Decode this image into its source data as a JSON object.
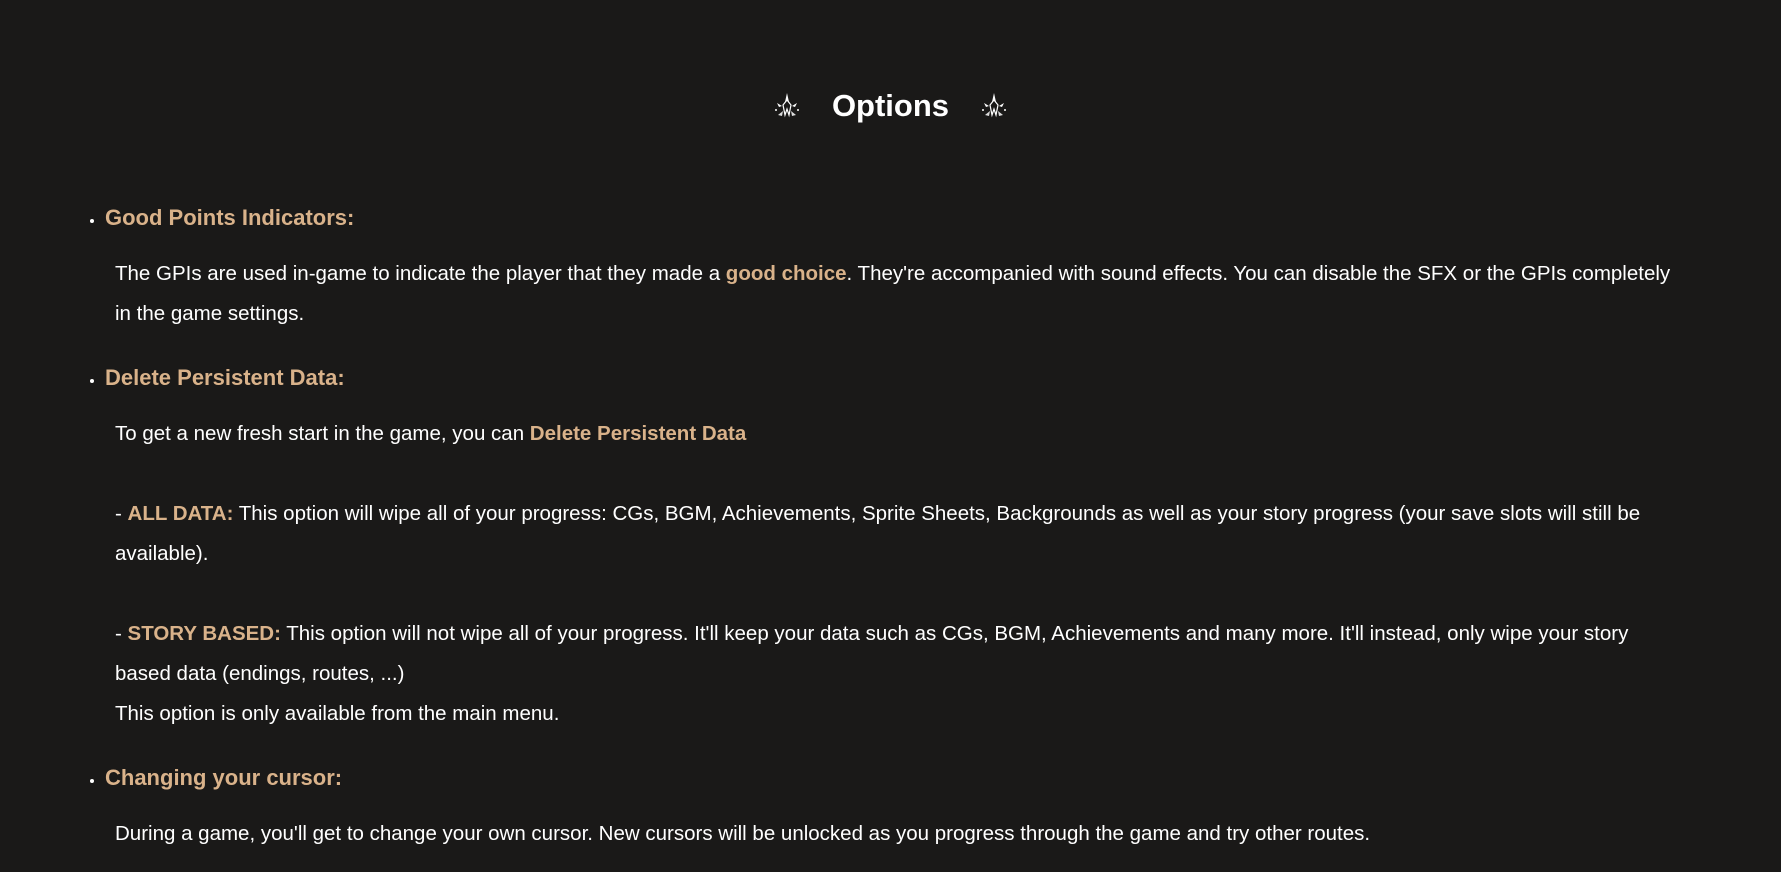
{
  "header": {
    "title": "Options",
    "decor_icon": "star-burst-icon"
  },
  "colors": {
    "background": "#1a1918",
    "accent": "#d9b28a",
    "text": "#ffffff"
  },
  "sections": {
    "gpi": {
      "heading": "Good Points Indicators:",
      "p1_a": "The GPIs are used in-game to indicate the player that they made a ",
      "p1_hl": "good choice",
      "p1_b": ". They're accompanied with sound effects. You can disable the SFX or the GPIs completely in the game settings."
    },
    "delete": {
      "heading": "Delete Persistent Data:",
      "p1_a": "To get a new fresh start in the game, you can ",
      "p1_hl": "Delete Persistent Data",
      "all_prefix": "- ",
      "all_hl": "ALL DATA:",
      "all_text": " This option will wipe all of your progress: CGs, BGM, Achievements, Sprite Sheets, Backgrounds as well as your story progress (your save slots will still be available).",
      "story_prefix": "- ",
      "story_hl": "STORY BASED:",
      "story_text": " This option will not wipe all of your progress. It'll keep your data such as CGs, BGM, Achievements and many more. It'll instead, only wipe your story based data (endings, routes, ...)",
      "note": "This option is only available from the main menu."
    },
    "cursor": {
      "heading": "Changing your cursor:",
      "p1": "During a game, you'll get to change your own cursor. New cursors will be unlocked as you progress through the game and try other routes."
    }
  }
}
